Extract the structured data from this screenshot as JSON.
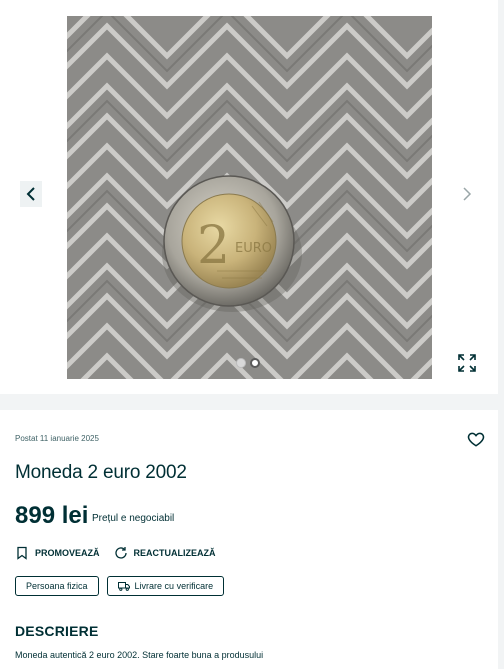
{
  "gallery": {
    "photo_alt": "coin-photo",
    "slide_total": 2,
    "slide_active": 2,
    "icons": {
      "prev": "chevron-left-icon",
      "next": "chevron-right-icon",
      "fullscreen": "expand-icon"
    }
  },
  "listing": {
    "posted": "Postat 11 ianuarie 2025",
    "title": "Moneda 2 euro 2002",
    "price": "899 lei",
    "negotiable": "Prețul e negociabil",
    "actions": [
      {
        "label": "PROMOVEAZĂ",
        "icon": "bookmark-icon"
      },
      {
        "label": "REACTUALIZEAZĂ",
        "icon": "refresh-icon"
      }
    ],
    "tags": [
      {
        "label": "Persoana fizica"
      },
      {
        "label": "Livrare cu verificare",
        "icon": "truck-icon"
      }
    ],
    "description_heading": "DESCRIERE",
    "description": "Moneda autentică 2 euro 2002. Stare foarte buna a produsului"
  },
  "colors": {
    "primary": "#002f34",
    "background": "#f2f4f5"
  }
}
